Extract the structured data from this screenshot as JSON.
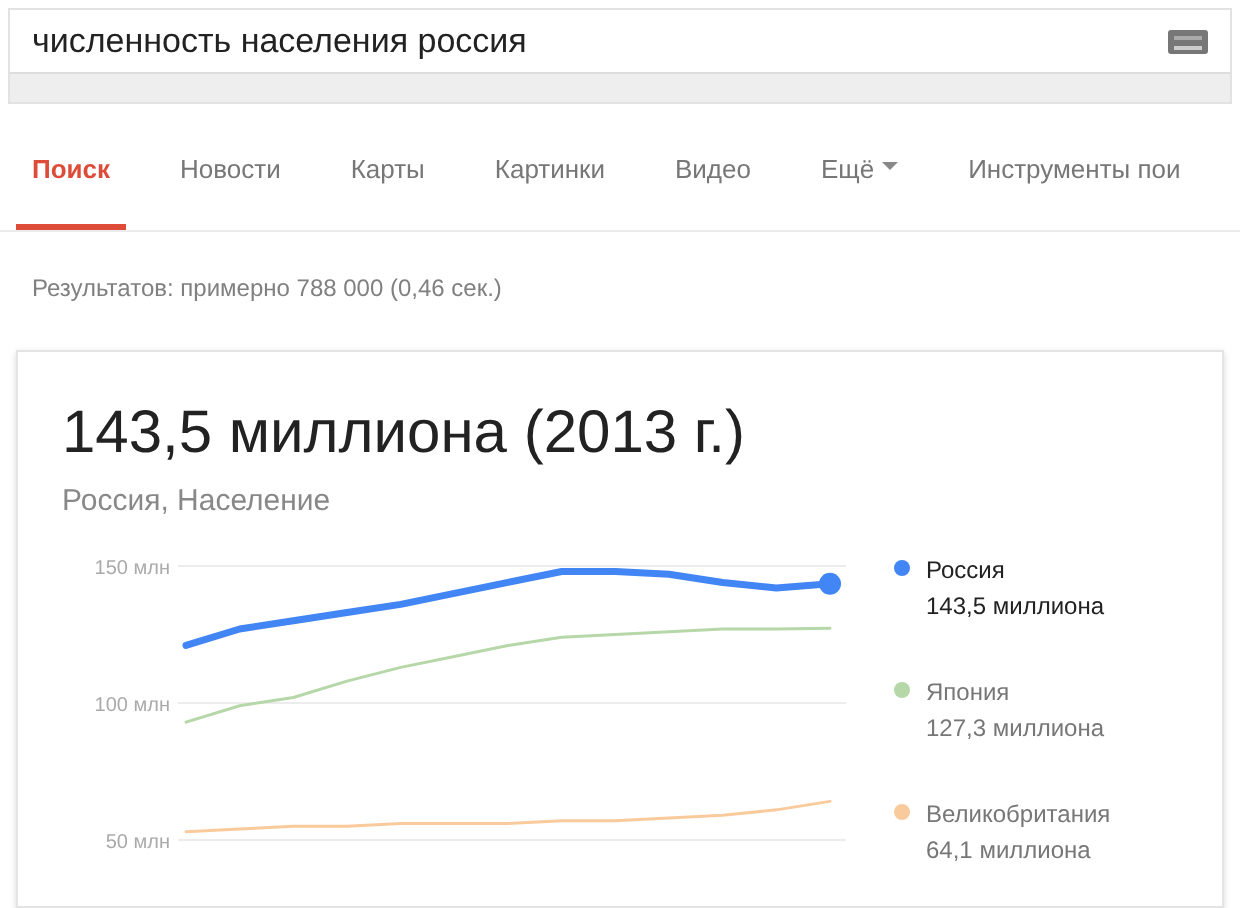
{
  "search": {
    "value": "численность населения россия"
  },
  "tabs": [
    {
      "label": "Поиск",
      "selected": true
    },
    {
      "label": "Новости",
      "selected": false
    },
    {
      "label": "Карты",
      "selected": false
    },
    {
      "label": "Картинки",
      "selected": false
    },
    {
      "label": "Видео",
      "selected": false
    },
    {
      "label": "Ещё",
      "selected": false,
      "kind": "menu"
    },
    {
      "label": "Инструменты пои",
      "selected": false
    }
  ],
  "results_count": "Результатов: примерно 788 000 (0,46 сек.)",
  "card": {
    "headline": "143,5 миллиона (2013 г.)",
    "subtitle": "Россия, Население",
    "legend": [
      {
        "value": "143,5 миллиона"
      },
      {
        "value": "127,3 миллиона"
      },
      {
        "value": "64,1 миллиона"
      }
    ],
    "chart_data": {
      "type": "line",
      "grid": true,
      "ylim": [
        50,
        150
      ],
      "yticks": [
        {
          "value": 50,
          "label": "50 млн"
        },
        {
          "value": 100,
          "label": "100 млн"
        },
        {
          "value": 150,
          "label": "150 млн"
        }
      ],
      "series": [
        {
          "name": "Россия",
          "color": "#4285f4",
          "values": [
            121,
            127,
            130,
            133,
            136,
            140,
            144,
            148,
            148,
            147,
            144,
            142,
            143.5
          ]
        },
        {
          "name": "Япония",
          "color": "#b6d7a8",
          "values": [
            93,
            99,
            102,
            108,
            113,
            117,
            121,
            124,
            125,
            126,
            127,
            127,
            127.3
          ]
        },
        {
          "name": "Великобритания",
          "color": "#f9cb9c",
          "values": [
            53,
            54,
            55,
            55,
            56,
            56,
            56,
            57,
            57,
            58,
            59,
            61,
            64.1
          ]
        }
      ]
    }
  }
}
